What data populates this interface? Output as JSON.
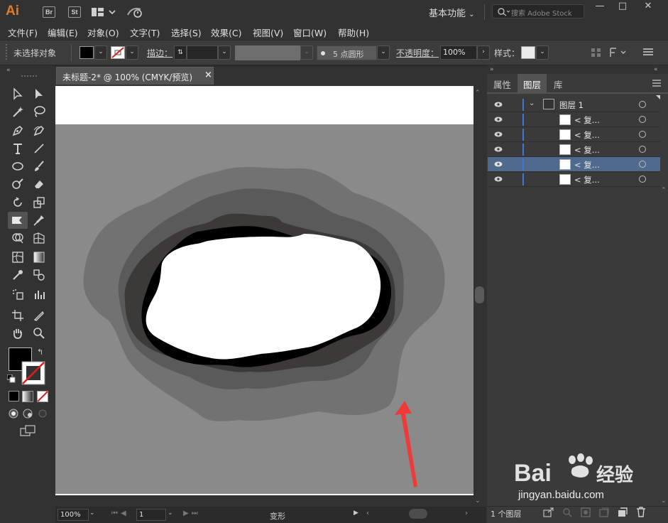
{
  "app": {
    "logo": "Ai",
    "bridge": "Br",
    "stock": "St",
    "workspace": "基本功能",
    "search_placeholder": "搜索 Adobe Stock",
    "minimize": "—",
    "maximize": "□",
    "close": "✕"
  },
  "menubar": [
    "文件(F)",
    "编辑(E)",
    "对象(O)",
    "文字(T)",
    "选择(S)",
    "效果(C)",
    "视图(V)",
    "窗口(W)",
    "帮助(H)"
  ],
  "controlbar": {
    "selection_status": "未选择对象",
    "stroke_label": "描边：",
    "brush_value": "5 点圆形",
    "opacity_label": "不透明度：",
    "opacity_value": "100%",
    "style_label": "样式："
  },
  "document": {
    "tab_title": "未标题-2* @ 100% (CMYK/预览)",
    "tab_close": "×"
  },
  "statusbar": {
    "zoom": "100%",
    "artboard_number": "1",
    "tool_status": "变形"
  },
  "panel": {
    "tabs": [
      "属性",
      "图层",
      "库"
    ],
    "active_tab": "图层",
    "layers": [
      {
        "label": "图层 1",
        "type": "layer",
        "selected": false
      },
      {
        "label": "< 复...",
        "type": "path",
        "selected": false
      },
      {
        "label": "< 复...",
        "type": "path",
        "selected": false
      },
      {
        "label": "< 复...",
        "type": "path",
        "selected": false
      },
      {
        "label": "< 复...",
        "type": "path",
        "selected": true
      },
      {
        "label": "< 复...",
        "type": "path",
        "selected": false
      }
    ],
    "layer_count": "1 个图层"
  },
  "watermark": {
    "brand": "Bai",
    "brand2": "经验",
    "url": "jingyan.baidu.com"
  },
  "colors": {
    "accent_orange": "#e57a22",
    "selected_row": "#4f6a8c",
    "layer_color": "#3d77d9",
    "arrow_red": "#f03a3a"
  }
}
